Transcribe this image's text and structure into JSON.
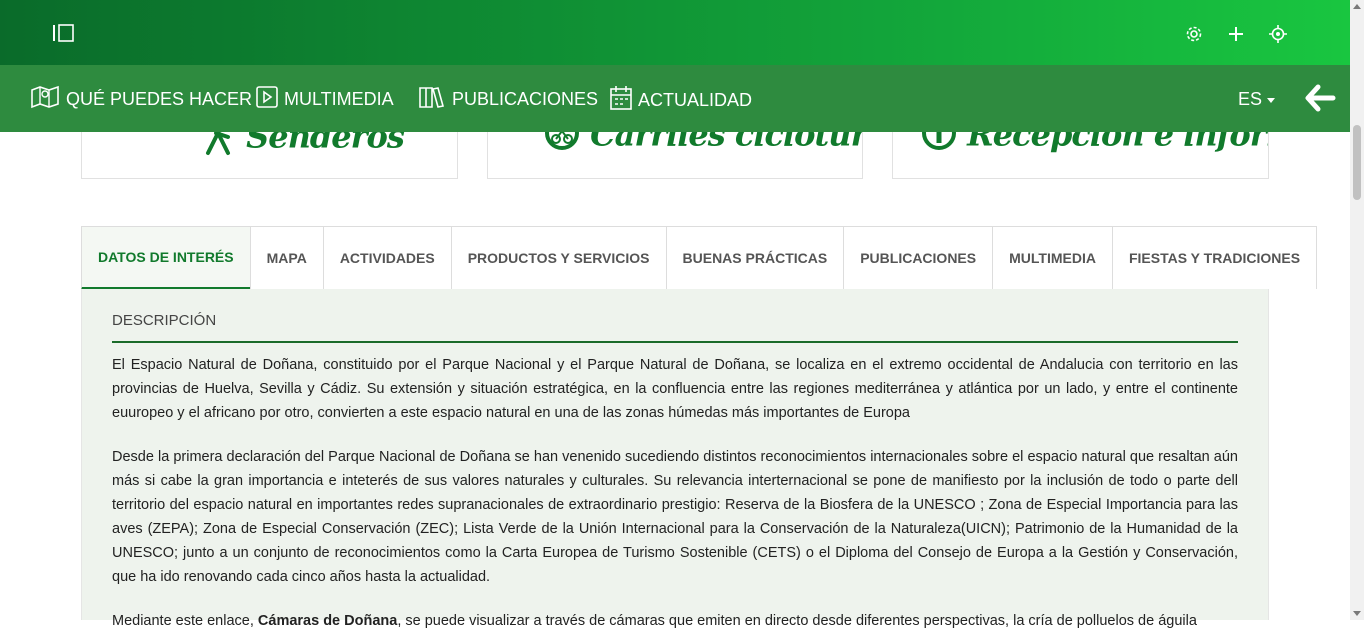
{
  "topbar": {
    "icons": [
      "sidebar-toggle-icon",
      "settings-icon",
      "plus-icon",
      "location-target-icon"
    ]
  },
  "nav": {
    "items": [
      {
        "label": "QUÉ PUEDES HACER",
        "icon": "map-icon"
      },
      {
        "label": "MULTIMEDIA",
        "icon": "video-icon"
      },
      {
        "label": "PUBLICACIONES",
        "icon": "book-icon"
      },
      {
        "label": "ACTUALIDAD",
        "icon": "calendar-icon"
      }
    ],
    "lang": "ES"
  },
  "cards": [
    {
      "label": "Senderos",
      "icon": "hiker-icon"
    },
    {
      "label": "Carriles cicloturistas",
      "icon": "bike-icon"
    },
    {
      "label": "Recepción e información",
      "icon": "info-icon"
    }
  ],
  "tabs": [
    "DATOS DE INTERÉS",
    "MAPA",
    "ACTIVIDADES",
    "PRODUCTOS Y SERVICIOS",
    "BUENAS PRÁCTICAS",
    "PUBLICACIONES",
    "MULTIMEDIA",
    "FIESTAS Y TRADICIONES"
  ],
  "content": {
    "section_title": "DESCRIPCIÓN",
    "p1": "El Espacio Natural de Doñana, constituido por el Parque Nacional y el Parque Natural de Doñana, se localiza en el extremo occidental de Andalucia con territorio en las provincias de Huelva, Sevilla y Cádiz. Su extensión y situación estratégica, en la confluencia entre las regiones mediterránea y atlántica por un lado, y entre el continente euuropeo y el africano por otro, convierten a este espacio natural en una de las zonas húmedas más importantes de Europa",
    "p2": "Desde la primera declaración del Parque Nacional de Doñana se han venenido sucediendo distintos reconocimientos internacionales sobre el espacio natural que resaltan aún más si cabe la gran importancia e inteterés de sus valores naturales y culturales. Su relevancia interternacional se pone de manifiesto por la inclusión de todo o parte dell territorio del espacio natural en importantes redes supranacionales de extraordinario prestigio: Reserva de la Biosfera de la UNESCO ; Zona de Especial Importancia para las aves (ZEPA); Zona de Especial Conservación (ZEC); Lista Verde de la Unión Internacional para la Conservación de la Naturaleza(UICN); Patrimonio de la Humanidad de la UNESCO; junto a un conjunto de reconocimientos como la Carta Europea de Turismo Sostenible (CETS) o el Diploma del Consejo de Europa a la Gestión y Conservación, que ha ido renovando cada cinco años hasta la actualidad.",
    "p3_prefix": "Mediante este enlace, ",
    "p3_link": "Cámaras de Doñana",
    "p3_suffix": ", se puede visualizar a través de cámaras que emiten en directo desde diferentes perspectivas, la cría de polluelos de águila"
  },
  "colors": {
    "brand_green": "#117a2c",
    "nav_green": "#2e8b3f"
  }
}
